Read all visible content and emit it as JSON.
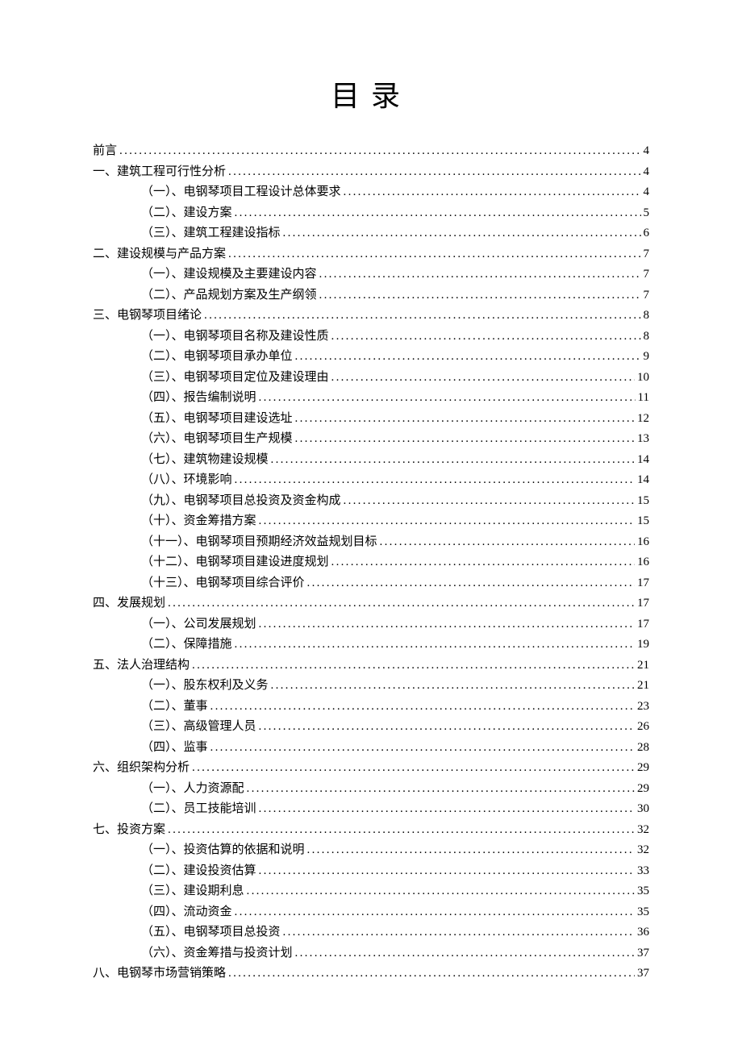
{
  "title": "目录",
  "entries": [
    {
      "level": 0,
      "text": "前言",
      "page": "4"
    },
    {
      "level": 0,
      "text": "一、建筑工程可行性分析",
      "page": "4"
    },
    {
      "level": 1,
      "text": "（一）、电钢琴项目工程设计总体要求",
      "page": "4"
    },
    {
      "level": 1,
      "text": "（二）、建设方案",
      "page": "5"
    },
    {
      "level": 1,
      "text": "（三）、建筑工程建设指标",
      "page": "6"
    },
    {
      "level": 0,
      "text": "二、建设规模与产品方案",
      "page": "7"
    },
    {
      "level": 1,
      "text": "（一）、建设规模及主要建设内容",
      "page": "7"
    },
    {
      "level": 1,
      "text": "（二）、产品规划方案及生产纲领",
      "page": "7"
    },
    {
      "level": 0,
      "text": "三、电钢琴项目绪论",
      "page": "8"
    },
    {
      "level": 1,
      "text": "（一）、电钢琴项目名称及建设性质",
      "page": "8"
    },
    {
      "level": 1,
      "text": "（二）、电钢琴项目承办单位",
      "page": "9"
    },
    {
      "level": 1,
      "text": "（三）、电钢琴项目定位及建设理由",
      "page": "10"
    },
    {
      "level": 1,
      "text": "（四）、报告编制说明",
      "page": "11"
    },
    {
      "level": 1,
      "text": "（五）、电钢琴项目建设选址",
      "page": "12"
    },
    {
      "level": 1,
      "text": "（六）、电钢琴项目生产规模",
      "page": "13"
    },
    {
      "level": 1,
      "text": "（七）、建筑物建设规模",
      "page": "14"
    },
    {
      "level": 1,
      "text": "（八）、环境影响",
      "page": "14"
    },
    {
      "level": 1,
      "text": "（九）、电钢琴项目总投资及资金构成",
      "page": "15"
    },
    {
      "level": 1,
      "text": "（十）、资金筹措方案",
      "page": "15"
    },
    {
      "level": 1,
      "text": "（十一）、电钢琴项目预期经济效益规划目标",
      "page": "16"
    },
    {
      "level": 1,
      "text": "（十二）、电钢琴项目建设进度规划",
      "page": "16"
    },
    {
      "level": 1,
      "text": "（十三）、电钢琴项目综合评价",
      "page": "17"
    },
    {
      "level": 0,
      "text": "四、发展规划",
      "page": "17"
    },
    {
      "level": 1,
      "text": "（一）、公司发展规划",
      "page": "17"
    },
    {
      "level": 1,
      "text": "（二）、保障措施",
      "page": "19"
    },
    {
      "level": 0,
      "text": "五、法人治理结构",
      "page": "21"
    },
    {
      "level": 1,
      "text": "（一）、股东权利及义务",
      "page": "21"
    },
    {
      "level": 1,
      "text": "（二）、董事",
      "page": "23"
    },
    {
      "level": 1,
      "text": "（三）、高级管理人员",
      "page": "26"
    },
    {
      "level": 1,
      "text": "（四）、监事",
      "page": "28"
    },
    {
      "level": 0,
      "text": "六、组织架构分析",
      "page": "29"
    },
    {
      "level": 1,
      "text": "（一）、人力资源配",
      "page": "29"
    },
    {
      "level": 1,
      "text": "（二）、员工技能培训",
      "page": "30"
    },
    {
      "level": 0,
      "text": "七、投资方案",
      "page": "32"
    },
    {
      "level": 1,
      "text": "（一）、投资估算的依据和说明",
      "page": "32"
    },
    {
      "level": 1,
      "text": "（二）、建设投资估算",
      "page": "33"
    },
    {
      "level": 1,
      "text": "（三）、建设期利息",
      "page": "35"
    },
    {
      "level": 1,
      "text": "（四）、流动资金",
      "page": "35"
    },
    {
      "level": 1,
      "text": "（五）、电钢琴项目总投资",
      "page": "36"
    },
    {
      "level": 1,
      "text": "（六）、资金筹措与投资计划",
      "page": "37"
    },
    {
      "level": 0,
      "text": "八、电钢琴市场营销策略",
      "page": "37"
    }
  ]
}
